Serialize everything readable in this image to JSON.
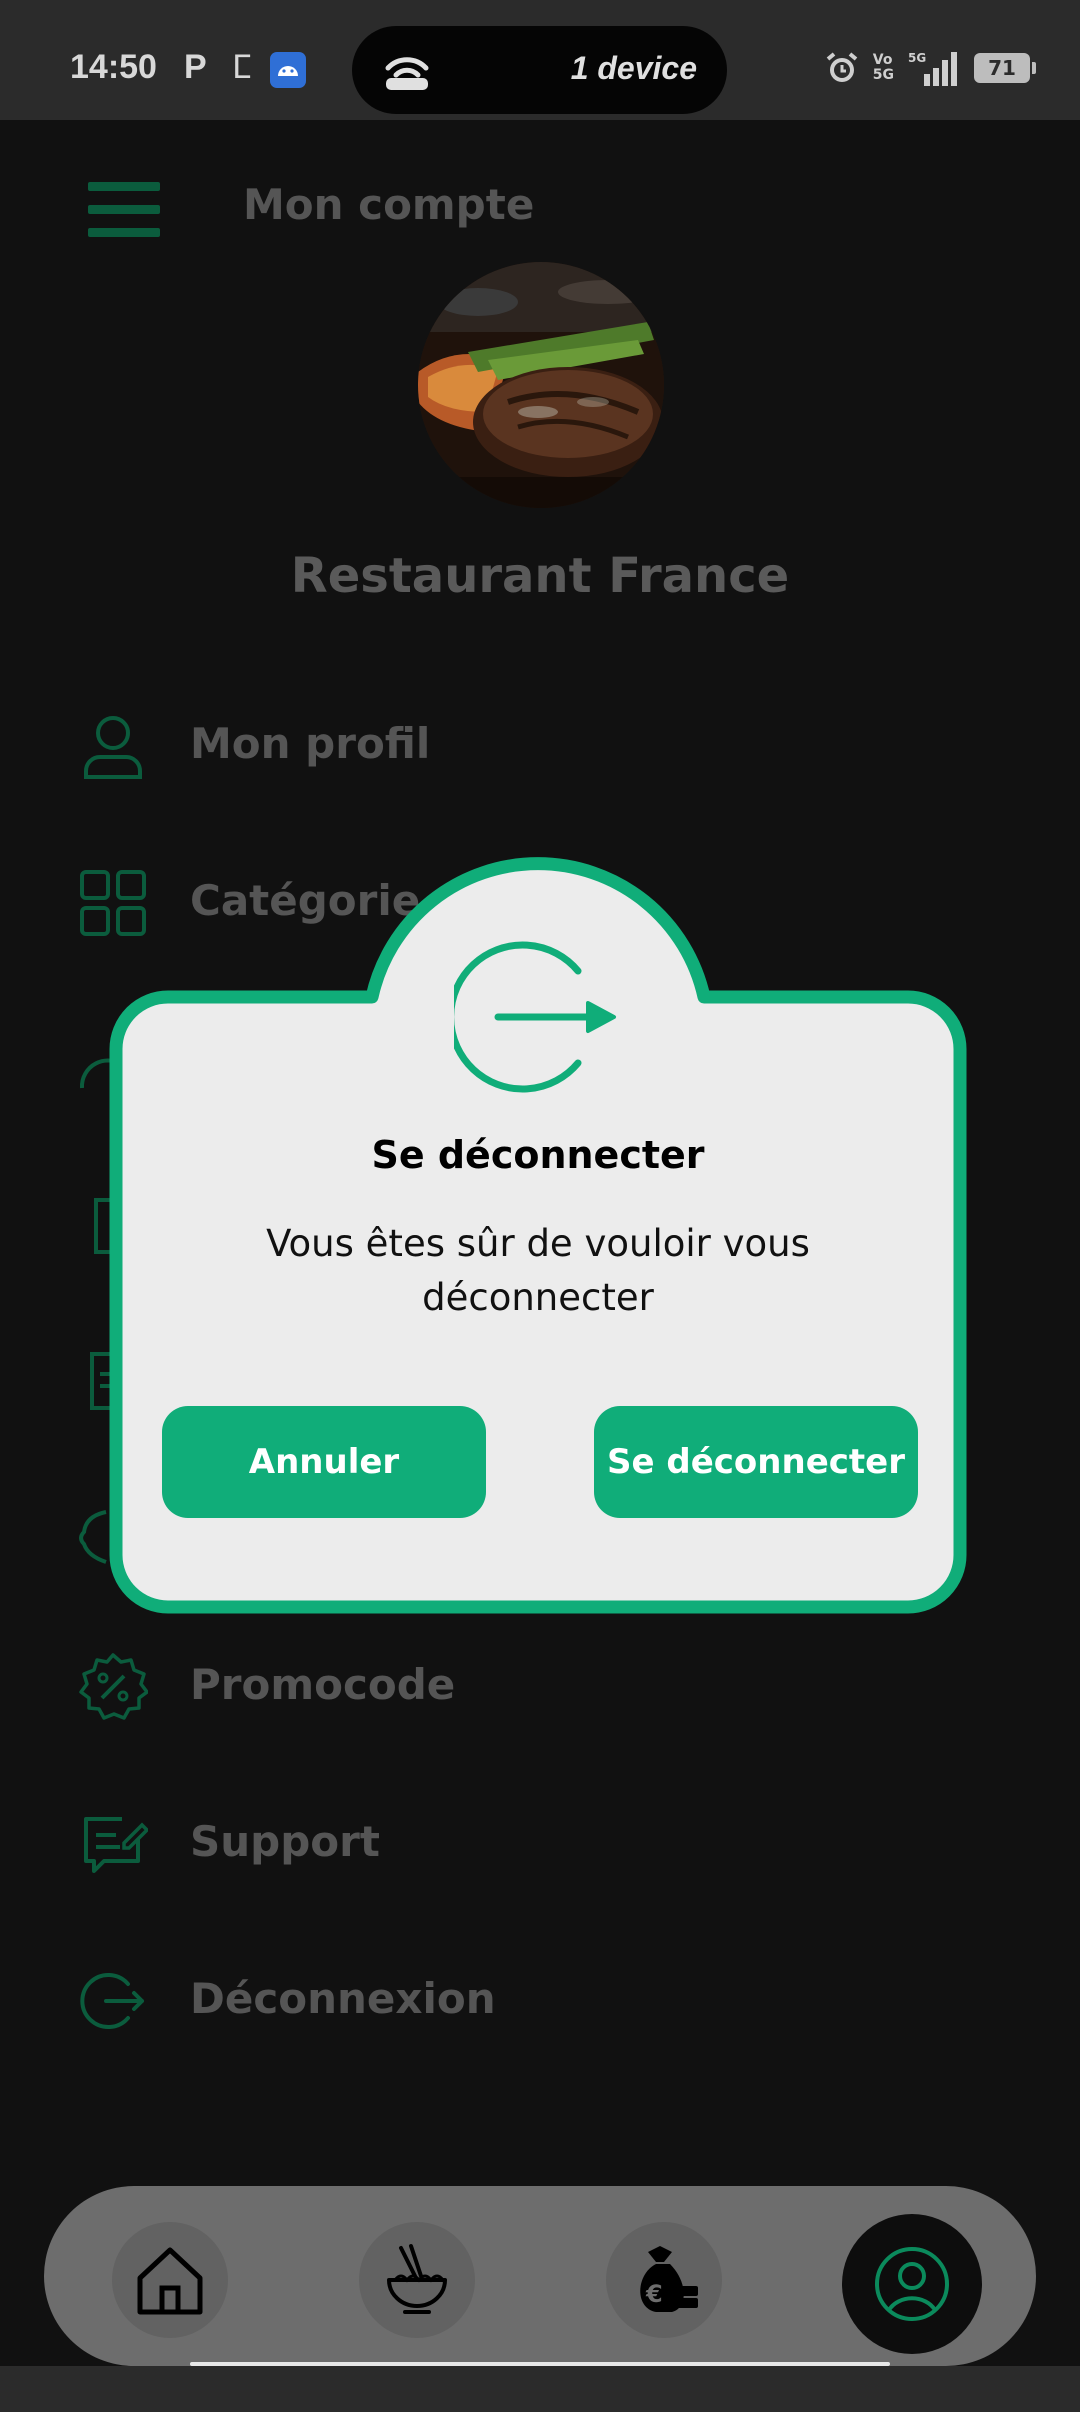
{
  "status_bar": {
    "time": "14:50",
    "p_icon": "P",
    "k_icon": "ⵎ",
    "hotspot_text": "1 device",
    "volte": "Vo\n5G",
    "battery": "71",
    "icons": [
      "android-icon",
      "hotspot-icon",
      "alarm-icon",
      "signal-5g-icon",
      "battery-icon"
    ]
  },
  "header": {
    "title": "Mon compte",
    "menu_icon": "hamburger-menu-icon"
  },
  "profile": {
    "name": "Restaurant France",
    "avatar": "steak-dish-photo"
  },
  "menu": {
    "items": [
      {
        "label": "Mon profil",
        "icon": "user-icon"
      },
      {
        "label": "Catégorie",
        "icon": "grid-icon"
      },
      {
        "label": "Promocode",
        "icon": "percent-badge-icon"
      },
      {
        "label": "Support",
        "icon": "message-edit-icon"
      },
      {
        "label": "Déconnexion",
        "icon": "logout-icon"
      }
    ]
  },
  "dialog": {
    "title": "Se déconnecter",
    "message": "Vous êtes sûr de vouloir vous déconnecter",
    "cancel_label": "Annuler",
    "confirm_label": "Se déconnecter",
    "icon": "logout-icon"
  },
  "bottom_nav": {
    "items": [
      "home-icon",
      "food-bowl-icon",
      "money-bag-euro-icon",
      "account-icon"
    ],
    "active": "account-icon"
  },
  "colors": {
    "accent": "#10ad79",
    "dark_green": "#0b5c3d",
    "overlay_bg": "#111111",
    "dialog_bg": "#ececec"
  }
}
